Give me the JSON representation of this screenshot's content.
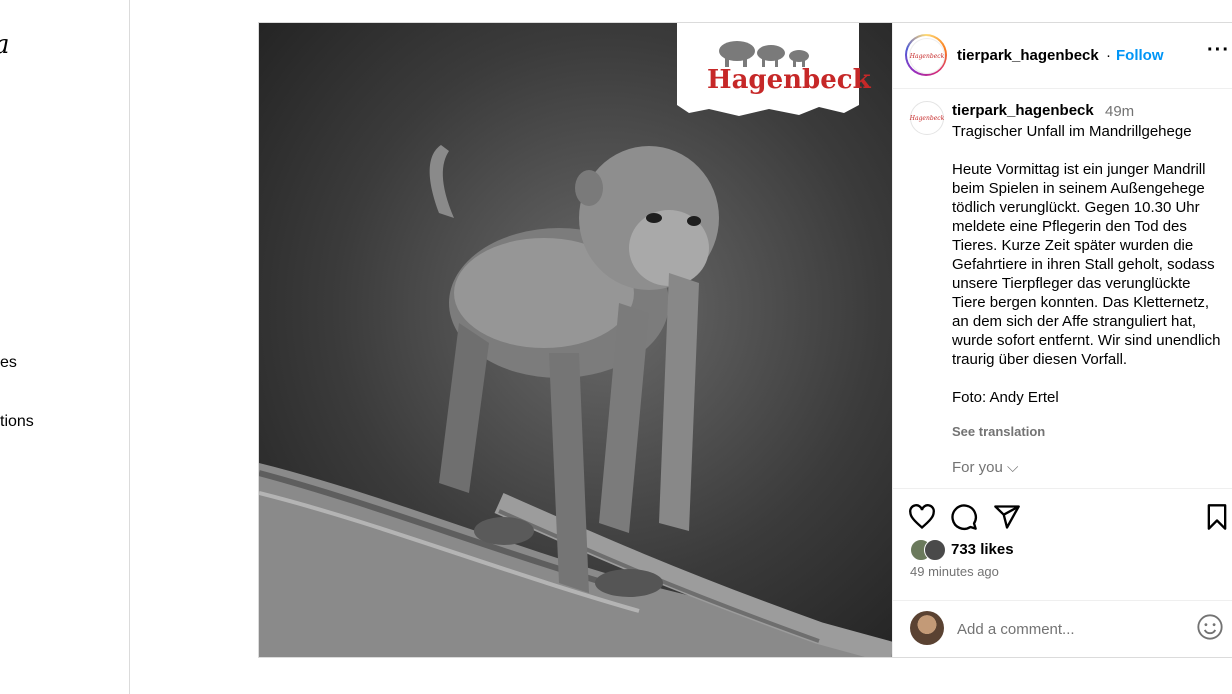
{
  "sidebar": {
    "logo_fragment": "a",
    "items": [
      {
        "label": "es"
      },
      {
        "label": "tions"
      }
    ]
  },
  "media": {
    "logo_text": "Hagenbeck",
    "subject": "monkey-on-rope-photo"
  },
  "header": {
    "username": "tierpark_hagenbeck",
    "separator": "·",
    "follow_label": "Follow",
    "more_label": "···",
    "avatar_text": "Hagenbeck"
  },
  "caption": {
    "username": "tierpark_hagenbeck",
    "time": "49m",
    "text": "Tragischer Unfall im Mandrillgehege\n\nHeute Vormittag ist ein junger Mandrill beim Spielen in seinem Außengehege tödlich verunglückt. Gegen 10.30 Uhr meldete eine Pflegerin den Tod des Tieres. Kurze Zeit später wurden die Gefahrtiere in ihren Stall geholt, sodass unsere Tierpfleger das verunglückte Tiere bergen konnten. Das Kletternetz, an dem sich der Affe stranguliert hat, wurde sofort entfernt. Wir sind unendlich traurig über diesen Vorfall.\n\nFoto: Andy Ertel",
    "see_translation": "See translation",
    "for_you": "For you ⌵"
  },
  "actions": {
    "likes": "733 likes",
    "time_ago": "49 minutes ago"
  },
  "comment": {
    "placeholder": "Add a comment..."
  },
  "colors": {
    "accent": "#0095f6",
    "muted": "#737373",
    "brand_red": "#c62828"
  }
}
